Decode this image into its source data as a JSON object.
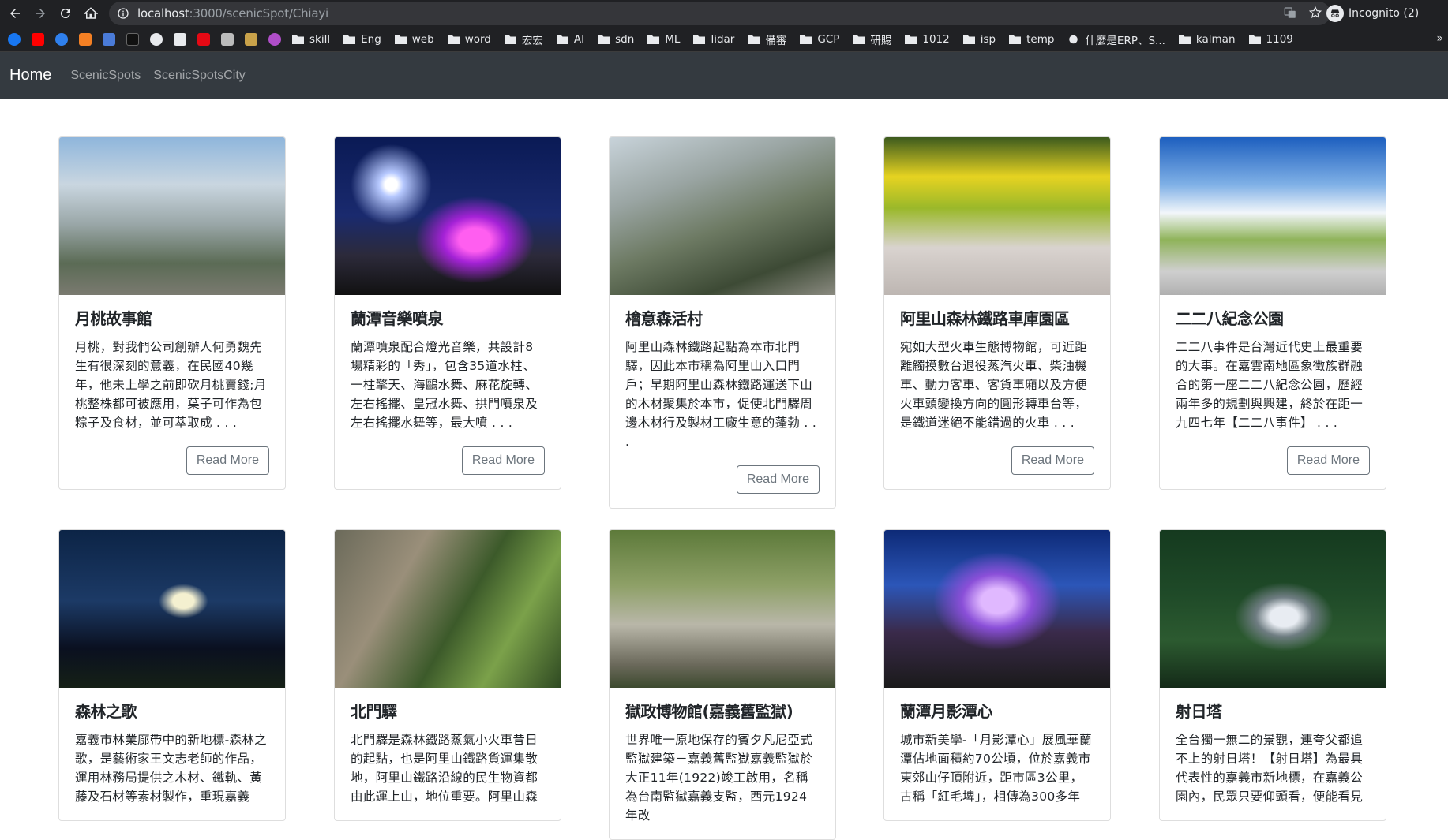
{
  "browser": {
    "url_host": "localhost",
    "url_path": ":3000/scenicSpot/Chiayi",
    "incognito_label": "Incognito (2)",
    "bookmarks": [
      {
        "label": "skill"
      },
      {
        "label": "Eng"
      },
      {
        "label": "web"
      },
      {
        "label": "word"
      },
      {
        "label": "宏宏"
      },
      {
        "label": "AI"
      },
      {
        "label": "sdn"
      },
      {
        "label": "ML"
      },
      {
        "label": "lidar"
      },
      {
        "label": "備審"
      },
      {
        "label": "GCP"
      },
      {
        "label": "研賜"
      },
      {
        "label": "1012"
      },
      {
        "label": "isp"
      },
      {
        "label": "temp"
      },
      {
        "label": "什麼是ERP、S..."
      },
      {
        "label": "kalman"
      },
      {
        "label": "1109"
      }
    ],
    "bookmarks_more": "»"
  },
  "navbar": {
    "brand": "Home",
    "links": [
      "ScenicSpots",
      "ScenicSpotsCity"
    ]
  },
  "cards": [
    {
      "title": "月桃故事館",
      "desc": "月桃，對我們公司創辦人何勇魏先生有很深刻的意義，在民國40幾年，他未上學之前即砍月桃賣錢;月桃整株都可被應用，葉子可作為包粽子及食材，並可萃取成 . . .",
      "button": "Read More"
    },
    {
      "title": "蘭潭音樂噴泉",
      "desc": "蘭潭噴泉配合燈光音樂，共設計8場精彩的「秀」，包含35道水柱、一柱擎天、海鷗水舞、麻花旋轉、左右搖擺、皇冠水舞、拱門噴泉及左右搖擺水舞等，最大噴 . . .",
      "button": "Read More"
    },
    {
      "title": "檜意森活村",
      "desc": "阿里山森林鐵路起點為本市北門驛，因此本市稱為阿里山入口門戶；早期阿里山森林鐵路運送下山的木材聚集於本市，促使北門驛周邊木材行及製材工廠生意的蓬勃 . . .",
      "button": "Read More"
    },
    {
      "title": "阿里山森林鐵路車庫園區",
      "desc": "宛如大型火車生態博物館，可近距離觸摸數台退役蒸汽火車、柴油機車、動力客車、客貨車廂以及方便火車頭變換方向的圓形轉車台等，是鐵道迷絕不能錯過的火車 . . .",
      "button": "Read More"
    },
    {
      "title": "二二八紀念公園",
      "desc": "二二八事件是台灣近代史上最重要的大事。在嘉雲南地區象徵族群融合的第一座二二八紀念公園，歷經兩年多的規劃與興建，終於在距一九四七年【二二八事件】 . . .",
      "button": "Read More"
    },
    {
      "title": "森林之歌",
      "desc": "嘉義市林業廊帶中的新地標-森林之歌，是藝術家王文志老師的作品，運用林務局提供之木材、鐵軌、黃藤及石材等素材製作，重現嘉義",
      "button": ""
    },
    {
      "title": "北門驛",
      "desc": "北門驛是森林鐵路蒸氣小火車昔日的起點，也是阿里山鐵路貨運集散地，阿里山鐵路沿線的民生物資都由此運上山，地位重要。阿里山森",
      "button": ""
    },
    {
      "title": "獄政博物館(嘉義舊監獄)",
      "desc": "世界唯一原地保存的賓夕凡尼亞式監獄建築－嘉義舊監獄嘉義監獄於大正11年(1922)竣工啟用，名稱為台南監獄嘉義支監，西元1924年改",
      "button": ""
    },
    {
      "title": "蘭潭月影潭心",
      "desc": "城市新美學-「月影潭心」展風華蘭潭佔地面積約70公頃，位於嘉義市東郊山仔頂附近，距市區3公里，古稱「紅毛埤」，相傳為300多年",
      "button": ""
    },
    {
      "title": "射日塔",
      "desc": "全台獨一無二的景觀，連夸父都追不上的射日塔！【射日塔】為最具代表性的嘉義市新地標，在嘉義公園內，民眾只要仰頭看，便能看見",
      "button": ""
    }
  ]
}
